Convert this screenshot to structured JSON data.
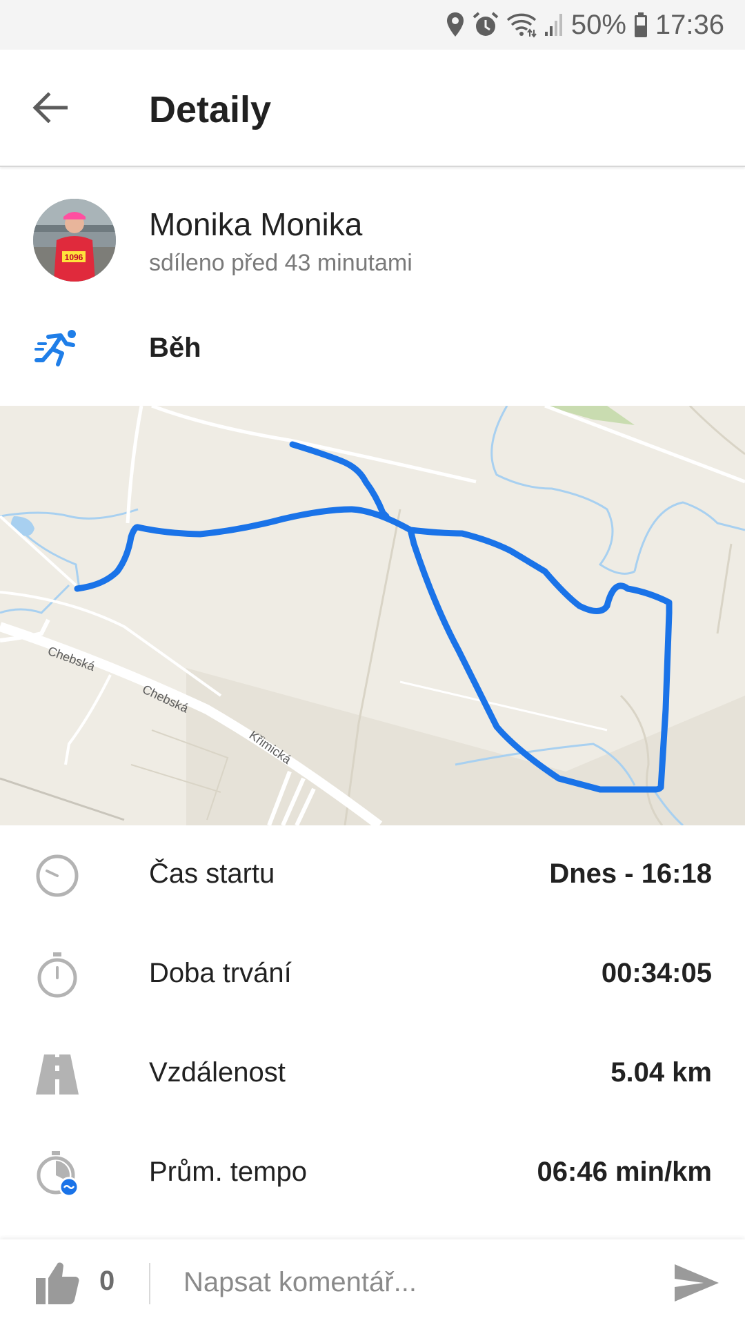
{
  "status_bar": {
    "battery_text": "50%",
    "time": "17:36",
    "icons": [
      "location-icon",
      "alarm-icon",
      "wifi-icon",
      "signal-icon",
      "battery-icon"
    ]
  },
  "app_bar": {
    "title": "Detaily",
    "back_icon": "arrow-left-icon"
  },
  "user": {
    "name": "Monika Monika",
    "shared_text": "sdíleno před 43 minutami",
    "avatar_bib": "1096"
  },
  "activity": {
    "label": "Běh",
    "icon": "running-icon",
    "accent_color": "#1f7ee8"
  },
  "map": {
    "streets": [
      "Chebská",
      "Chebská",
      "Křimická"
    ],
    "route_color": "#1a73e8"
  },
  "stats": [
    {
      "icon": "clock-icon",
      "label": "Čas startu",
      "value": "Dnes - 16:18"
    },
    {
      "icon": "stopwatch-icon",
      "label": "Doba trvání",
      "value": "00:34:05"
    },
    {
      "icon": "road-icon",
      "label": "Vzdálenost",
      "value": "5.04 km"
    },
    {
      "icon": "pace-icon",
      "label": "Prům. tempo",
      "value": "06:46 min/km"
    }
  ],
  "bottom_bar": {
    "like_count": "0",
    "comment_placeholder": "Napsat komentář..."
  }
}
